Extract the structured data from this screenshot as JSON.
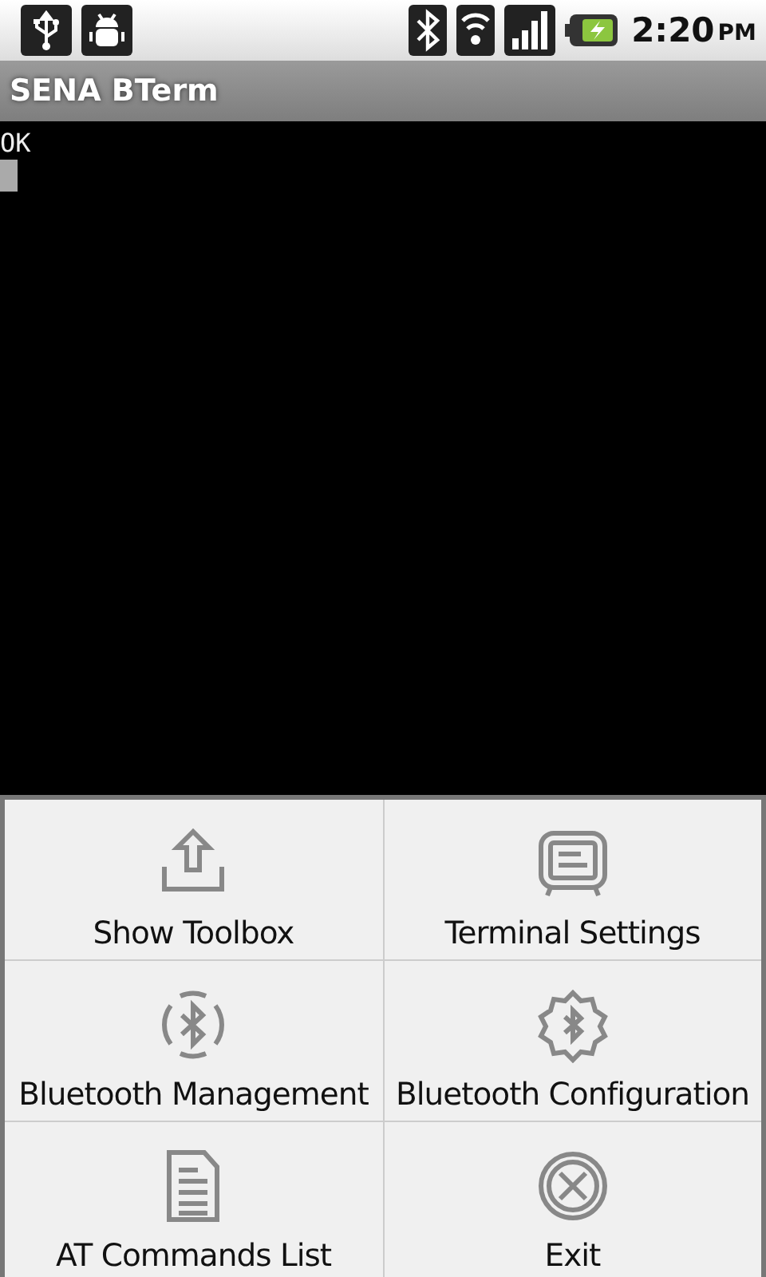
{
  "status_bar": {
    "time": "2:20",
    "meridiem": "PM"
  },
  "app_bar": {
    "title": "SENA BTerm"
  },
  "terminal": {
    "lines": [
      "OK"
    ],
    "cursor": true
  },
  "menu": [
    {
      "label": "Show Toolbox"
    },
    {
      "label": "Terminal Settings"
    },
    {
      "label": "Bluetooth Management"
    },
    {
      "label": "Bluetooth Configuration"
    },
    {
      "label": "AT Commands List"
    },
    {
      "label": "Exit"
    }
  ]
}
